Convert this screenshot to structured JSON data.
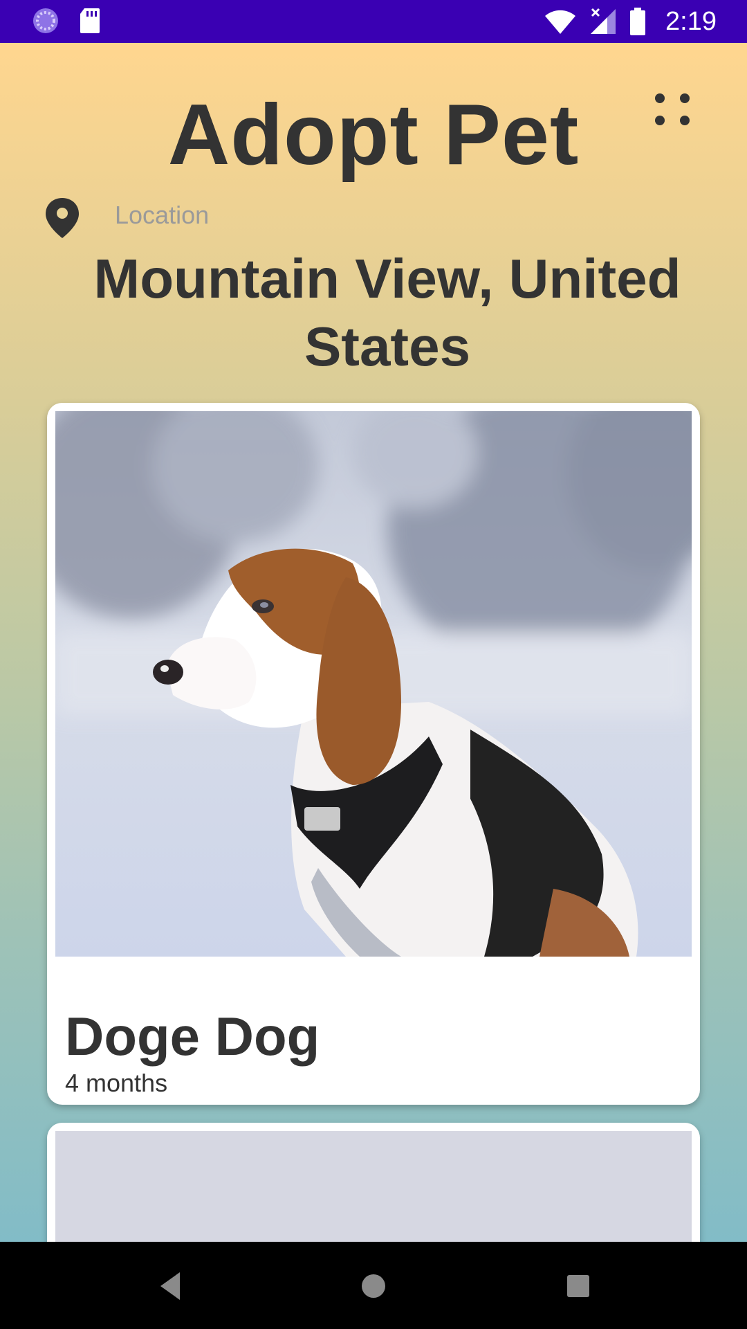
{
  "status_bar": {
    "time": "2:19",
    "background": "#3a00b3",
    "icons": [
      "loading-icon",
      "sd-card-icon",
      "wifi-icon",
      "cell-signal-icon",
      "battery-icon"
    ]
  },
  "app": {
    "title": "Adopt Pet",
    "menu_icon": "grid-dots-icon",
    "location": {
      "label": "Location",
      "value": "Mountain View, United States",
      "icon": "location-pin-icon"
    }
  },
  "pets": [
    {
      "name": "Doge Dog",
      "age": "4 months",
      "photo": "beagle-in-snow"
    },
    {
      "name": "",
      "age": "",
      "photo": "placeholder"
    }
  ],
  "nav_bar": {
    "buttons": [
      "back-icon",
      "home-icon",
      "recents-icon"
    ]
  }
}
